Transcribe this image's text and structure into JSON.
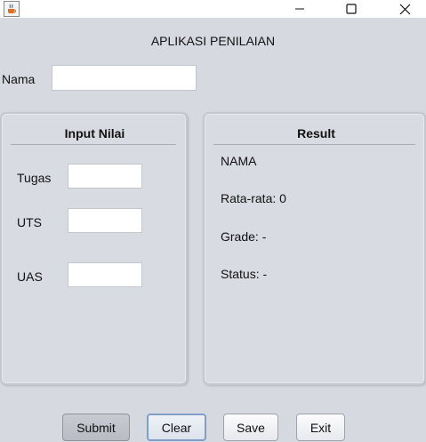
{
  "window": {
    "icon": "java-cup-icon",
    "controls": [
      "minimize-icon",
      "maximize-icon",
      "close-icon"
    ]
  },
  "app": {
    "title": "APLIKASI PENILAIAN"
  },
  "nama": {
    "label": "Nama",
    "value": ""
  },
  "input_panel": {
    "title": "Input Nilai",
    "fields": [
      {
        "label": "Tugas",
        "value": ""
      },
      {
        "label": "UTS",
        "value": ""
      },
      {
        "label": "UAS",
        "value": ""
      }
    ]
  },
  "result_panel": {
    "title": "Result",
    "nama": "NAMA",
    "rata_rata": "Rata-rata: 0",
    "grade": "Grade: -",
    "status": "Status: -"
  },
  "buttons": {
    "submit": "Submit",
    "clear": "Clear",
    "save": "Save",
    "exit": "Exit"
  },
  "colors": {
    "background": "#d6d9e0",
    "focus_border": "#7f9fc8"
  }
}
